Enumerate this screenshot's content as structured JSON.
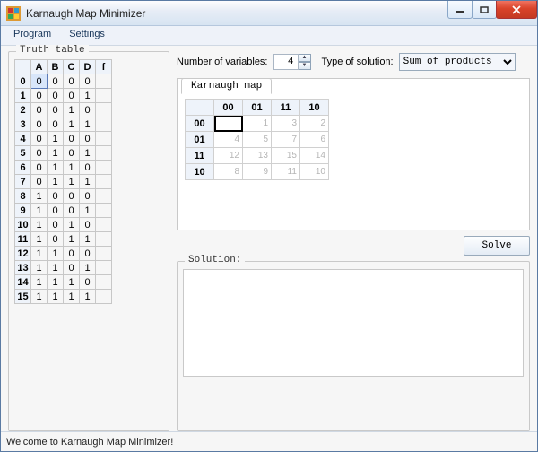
{
  "window": {
    "title": "Karnaugh Map Minimizer"
  },
  "menu": {
    "program": "Program",
    "settings": "Settings"
  },
  "truth_table": {
    "legend": "Truth table",
    "cols": [
      "A",
      "B",
      "C",
      "D",
      "f"
    ],
    "rows": [
      {
        "idx": "0",
        "v": [
          "0",
          "0",
          "0",
          "0"
        ]
      },
      {
        "idx": "1",
        "v": [
          "0",
          "0",
          "0",
          "1"
        ]
      },
      {
        "idx": "2",
        "v": [
          "0",
          "0",
          "1",
          "0"
        ]
      },
      {
        "idx": "3",
        "v": [
          "0",
          "0",
          "1",
          "1"
        ]
      },
      {
        "idx": "4",
        "v": [
          "0",
          "1",
          "0",
          "0"
        ]
      },
      {
        "idx": "5",
        "v": [
          "0",
          "1",
          "0",
          "1"
        ]
      },
      {
        "idx": "6",
        "v": [
          "0",
          "1",
          "1",
          "0"
        ]
      },
      {
        "idx": "7",
        "v": [
          "0",
          "1",
          "1",
          "1"
        ]
      },
      {
        "idx": "8",
        "v": [
          "1",
          "0",
          "0",
          "0"
        ]
      },
      {
        "idx": "9",
        "v": [
          "1",
          "0",
          "0",
          "1"
        ]
      },
      {
        "idx": "10",
        "v": [
          "1",
          "0",
          "1",
          "0"
        ]
      },
      {
        "idx": "11",
        "v": [
          "1",
          "0",
          "1",
          "1"
        ]
      },
      {
        "idx": "12",
        "v": [
          "1",
          "1",
          "0",
          "0"
        ]
      },
      {
        "idx": "13",
        "v": [
          "1",
          "1",
          "0",
          "1"
        ]
      },
      {
        "idx": "14",
        "v": [
          "1",
          "1",
          "1",
          "0"
        ]
      },
      {
        "idx": "15",
        "v": [
          "1",
          "1",
          "1",
          "1"
        ]
      }
    ]
  },
  "controls": {
    "numvars_label": "Number of variables:",
    "numvars_value": "4",
    "soltype_label": "Type of solution:",
    "soltype_value": "Sum of products"
  },
  "kmap": {
    "tab": "Karnaugh map",
    "col_labels": [
      "00",
      "01",
      "11",
      "10"
    ],
    "row_labels": [
      "00",
      "01",
      "11",
      "10"
    ],
    "cells": [
      [
        "",
        "1",
        "3",
        "2"
      ],
      [
        "4",
        "5",
        "7",
        "6"
      ],
      [
        "12",
        "13",
        "15",
        "14"
      ],
      [
        "8",
        "9",
        "11",
        "10"
      ]
    ]
  },
  "solve": {
    "button": "Solve"
  },
  "solution": {
    "legend": "Solution:"
  },
  "status": {
    "text": "Welcome to Karnaugh Map Minimizer!"
  }
}
